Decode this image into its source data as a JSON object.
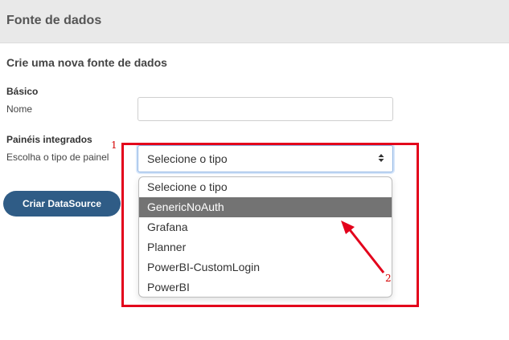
{
  "header": {
    "title": "Fonte de dados"
  },
  "form": {
    "subtitle": "Crie uma nova fonte de dados",
    "basic_section": "Básico",
    "name_label": "Nome",
    "name_value": "",
    "integrated_section": "Painéis integrados",
    "panel_type_label": "Escolha o tipo de painel",
    "panel_type_selected": "Selecione o tipo",
    "create_button": "Criar DataSource"
  },
  "dropdown": {
    "options": [
      "Selecione o tipo",
      "GenericNoAuth",
      "Grafana",
      "Planner",
      "PowerBI-CustomLogin",
      "PowerBI"
    ],
    "highlighted": "GenericNoAuth"
  },
  "annotations": {
    "label_1": "1",
    "label_2": "2",
    "color": "#e3001b"
  },
  "colors": {
    "header_bg": "#e9e9e9",
    "button_bg": "#2f5c86",
    "highlight_bg": "#737373"
  },
  "icons": {
    "select_arrows": "sort-arrows-icon"
  }
}
